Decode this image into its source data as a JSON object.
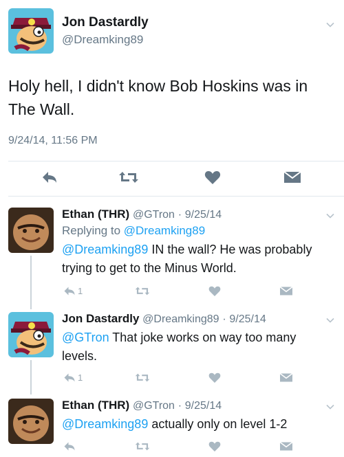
{
  "main": {
    "name": "Jon Dastardly",
    "handle": "@Dreamking89",
    "text": "Holy hell, I didn't know Bob Hoskins was in The Wall.",
    "timestamp": "9/24/14, 11:56 PM",
    "icons": [
      "reply-icon",
      "retweet-icon",
      "like-icon",
      "message-icon"
    ]
  },
  "replies": [
    {
      "name": "Ethan (THR)",
      "handle": "@GTron",
      "sep": "·",
      "date": "9/25/14",
      "replying_prefix": "Replying to",
      "replying_handle": "@Dreamking89",
      "mention": "@Dreamking89",
      "text": " IN the wall? He was probably trying to get to the Minus World.",
      "reply_count": "1"
    },
    {
      "name": "Jon Dastardly",
      "handle": "@Dreamking89",
      "sep": "·",
      "date": "9/25/14",
      "mention": "@GTron",
      "text": " That joke works on way too many levels.",
      "reply_count": "1"
    },
    {
      "name": "Ethan (THR)",
      "handle": "@GTron",
      "sep": "·",
      "date": "9/25/14",
      "mention": "@Dreamking89",
      "text": " actually only on level 1-2",
      "reply_count": ""
    }
  ],
  "colors": {
    "link": "#1da1f2",
    "muted": "#657786",
    "icon_main": "#657786",
    "icon_reply": "#aab8c2"
  }
}
